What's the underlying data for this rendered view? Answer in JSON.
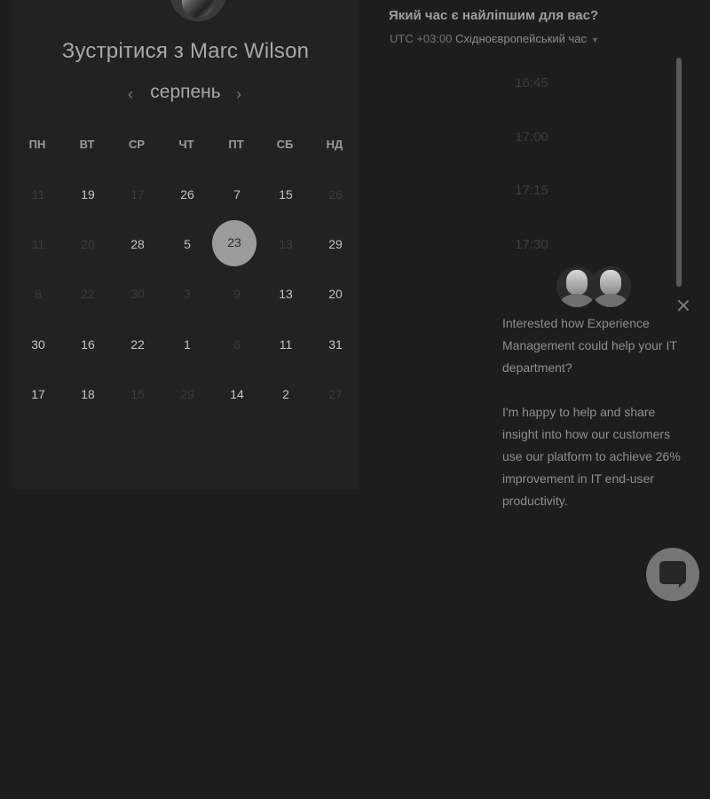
{
  "meeting": {
    "title": "Зустрітися з Marc Wilson",
    "month": "серпень",
    "prev_icon": "‹",
    "next_icon": "›"
  },
  "weekdays": [
    "ПН",
    "ВТ",
    "СР",
    "ЧТ",
    "ПТ",
    "СБ",
    "НД"
  ],
  "calendar_rows": [
    [
      {
        "d": "11",
        "active": false
      },
      {
        "d": "19",
        "active": true
      },
      {
        "d": "17",
        "active": false
      },
      {
        "d": "26",
        "active": true
      },
      {
        "d": "7",
        "active": true
      },
      {
        "d": "15",
        "active": true
      },
      {
        "d": "26",
        "active": false
      }
    ],
    [
      {
        "d": "11",
        "active": false
      },
      {
        "d": "20",
        "active": false
      },
      {
        "d": "28",
        "active": true
      },
      {
        "d": "5",
        "active": true
      },
      {
        "d": "23",
        "active": true,
        "selected": true
      },
      {
        "d": "13",
        "active": false
      },
      {
        "d": "29",
        "active": true
      }
    ],
    [
      {
        "d": "8",
        "active": false
      },
      {
        "d": "22",
        "active": false
      },
      {
        "d": "30",
        "active": false
      },
      {
        "d": "3",
        "active": false
      },
      {
        "d": "9",
        "active": false
      },
      {
        "d": "13",
        "active": true
      },
      {
        "d": "20",
        "active": true
      }
    ],
    [
      {
        "d": "30",
        "active": true
      },
      {
        "d": "16",
        "active": true
      },
      {
        "d": "22",
        "active": true
      },
      {
        "d": "1",
        "active": true
      },
      {
        "d": "6",
        "active": false
      },
      {
        "d": "11",
        "active": true
      },
      {
        "d": "31",
        "active": true
      }
    ],
    [
      {
        "d": "17",
        "active": true
      },
      {
        "d": "18",
        "active": true
      },
      {
        "d": "15",
        "active": false
      },
      {
        "d": "29",
        "active": false
      },
      {
        "d": "14",
        "active": true
      },
      {
        "d": "2",
        "active": true
      },
      {
        "d": "27",
        "active": false
      }
    ]
  ],
  "time_picker": {
    "question": "Який час є найліпшим для вас?",
    "tz_offset": "UTC +03:00",
    "tz_name": "Східноєвропейський час",
    "slots": [
      "16:45",
      "17:00",
      "17:15",
      "17:30"
    ]
  },
  "chat": {
    "message_1": "Interested how Experience Management could help your IT department?",
    "message_2": "I'm happy to help and share insight into how our customers use our platform to achieve 26% improvement in IT end-user productivity."
  }
}
